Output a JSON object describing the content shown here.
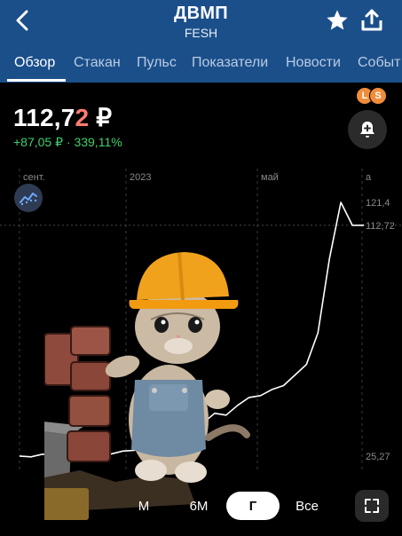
{
  "header": {
    "title": "ДВМП",
    "subtitle": "FESH",
    "back_icon": "chevron-left-icon",
    "favorite_icon": "star-icon",
    "share_icon": "share-upload-icon"
  },
  "tabs": [
    {
      "label": "Обзор",
      "active": true
    },
    {
      "label": "Стакан",
      "active": false
    },
    {
      "label": "Пульс",
      "active": false
    },
    {
      "label": "Показатели",
      "active": false
    },
    {
      "label": "Новости",
      "active": false
    },
    {
      "label": "Событ",
      "active": false
    }
  ],
  "quote": {
    "price_main": "112,7",
    "price_last_digit": "2",
    "currency": "₽",
    "change": "+87,05 ₽ · 339,11%",
    "badges": [
      "L",
      "S"
    ],
    "alert_icon": "add-alert-bell-icon"
  },
  "chart_data": {
    "type": "line",
    "x_labels": [
      "сент.",
      "2023",
      "май",
      "а"
    ],
    "y_tick_labels": [
      "121,4",
      "112,72",
      "25,27"
    ],
    "series": [
      {
        "values": [
          25.3,
          25.0,
          26.0,
          25.6,
          25.3,
          26.4,
          25.9,
          26.6,
          26.1,
          27.2,
          27.5,
          28.2,
          30.5,
          34.5,
          34.6,
          36.5,
          37.8,
          41.5,
          40.8,
          44.5,
          47.5,
          48.2,
          50.5,
          52.0,
          56.0,
          60.0,
          72.0,
          100.0,
          121.4,
          112.7,
          112.72
        ]
      }
    ],
    "accent_color": "#ffffff"
  },
  "indicator_icon": "indicators-chart-icon",
  "periods": [
    {
      "label": "М",
      "active": false
    },
    {
      "label": "6М",
      "active": false
    },
    {
      "label": "Г",
      "active": true
    },
    {
      "label": "Все",
      "active": false
    }
  ],
  "fullscreen_icon": "expand-icon",
  "colors": {
    "header": "#1b4f8a",
    "positive": "#3ecf6b",
    "price_highlight": "#ff7b72",
    "badge": "#f08d3b"
  }
}
